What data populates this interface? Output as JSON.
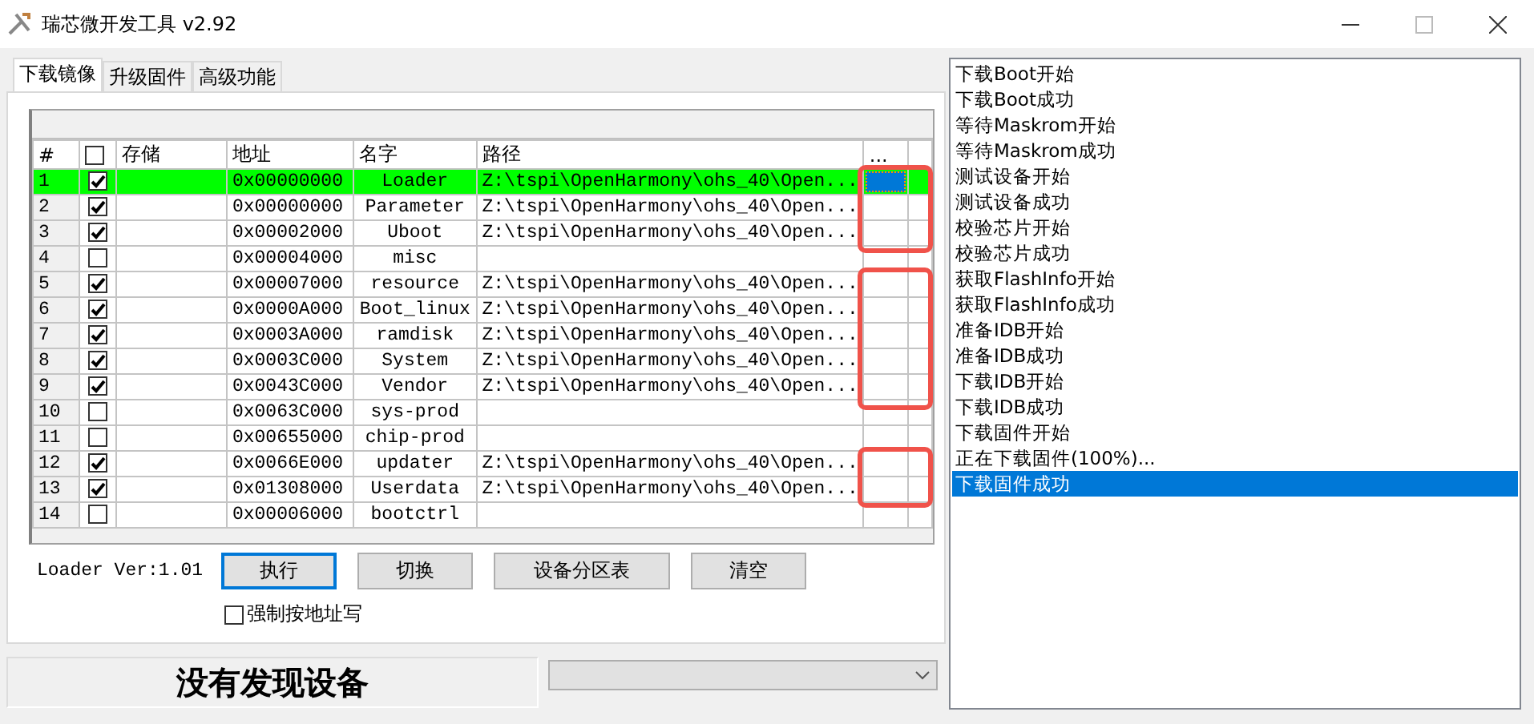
{
  "window": {
    "title": "瑞芯微开发工具 v2.92"
  },
  "tabs": [
    {
      "label": "下载镜像",
      "selected": true
    },
    {
      "label": "升级固件",
      "selected": false
    },
    {
      "label": "高级功能",
      "selected": false
    }
  ],
  "table": {
    "columns": [
      {
        "kind": "text",
        "label": "#"
      },
      {
        "kind": "checkbox",
        "checked": false
      },
      {
        "kind": "text",
        "label": "存储"
      },
      {
        "kind": "text",
        "label": "地址"
      },
      {
        "kind": "text",
        "label": "名字"
      },
      {
        "kind": "text",
        "label": "路径"
      },
      {
        "kind": "text",
        "label": "..."
      }
    ],
    "rows": [
      {
        "index": "1",
        "checked": true,
        "address": "0x00000000",
        "name": "Loader",
        "path": "Z:\\tspi\\OpenHarmony\\ohs_40\\Open...",
        "selected": true,
        "highlighted": true
      },
      {
        "index": "2",
        "checked": true,
        "address": "0x00000000",
        "name": "Parameter",
        "path": "Z:\\tspi\\OpenHarmony\\ohs_40\\Open...",
        "selected": false,
        "highlighted": true
      },
      {
        "index": "3",
        "checked": true,
        "address": "0x00002000",
        "name": "Uboot",
        "path": "Z:\\tspi\\OpenHarmony\\ohs_40\\Open...",
        "selected": false,
        "highlighted": true
      },
      {
        "index": "4",
        "checked": false,
        "address": "0x00004000",
        "name": "misc",
        "selected": false,
        "highlighted": false
      },
      {
        "index": "5",
        "checked": true,
        "address": "0x00007000",
        "name": "resource",
        "path": "Z:\\tspi\\OpenHarmony\\ohs_40\\Open...",
        "selected": false,
        "highlighted": true
      },
      {
        "index": "6",
        "checked": true,
        "address": "0x0000A000",
        "name": "Boot_linux",
        "path": "Z:\\tspi\\OpenHarmony\\ohs_40\\Open...",
        "selected": false,
        "highlighted": true
      },
      {
        "index": "7",
        "checked": true,
        "address": "0x0003A000",
        "name": "ramdisk",
        "path": "Z:\\tspi\\OpenHarmony\\ohs_40\\Open...",
        "selected": false,
        "highlighted": true
      },
      {
        "index": "8",
        "checked": true,
        "address": "0x0003C000",
        "name": "System",
        "path": "Z:\\tspi\\OpenHarmony\\ohs_40\\Open...",
        "selected": false,
        "highlighted": true
      },
      {
        "index": "9",
        "checked": true,
        "address": "0x0043C000",
        "name": "Vendor",
        "path": "Z:\\tspi\\OpenHarmony\\ohs_40\\Open...",
        "selected": false,
        "highlighted": true
      },
      {
        "index": "10",
        "checked": false,
        "address": "0x0063C000",
        "name": "sys-prod",
        "selected": false,
        "highlighted": false
      },
      {
        "index": "11",
        "checked": false,
        "address": "0x00655000",
        "name": "chip-prod",
        "selected": false,
        "highlighted": false
      },
      {
        "index": "12",
        "checked": true,
        "address": "0x0066E000",
        "name": "updater",
        "path": "Z:\\tspi\\OpenHarmony\\ohs_40\\Open...",
        "selected": false,
        "highlighted": true
      },
      {
        "index": "13",
        "checked": true,
        "address": "0x01308000",
        "name": "Userdata",
        "path": "Z:\\tspi\\OpenHarmony\\ohs_40\\Open...",
        "selected": false,
        "highlighted": true
      },
      {
        "index": "14",
        "checked": false,
        "address": "0x00006000",
        "name": "bootctrl",
        "selected": false,
        "highlighted": false
      }
    ]
  },
  "loader_version": "Loader Ver:1.01",
  "buttons": [
    {
      "label": "执行",
      "focused": true
    },
    {
      "label": "切换",
      "focused": false
    },
    {
      "label": "设备分区表",
      "focused": false
    },
    {
      "label": "清空",
      "focused": false
    }
  ],
  "force_address_write": {
    "label": "强制按地址写",
    "checked": false
  },
  "status": "没有发现设备",
  "log": [
    {
      "text": "下载Boot开始",
      "selected": false
    },
    {
      "text": "下载Boot成功",
      "selected": false
    },
    {
      "text": "等待Maskrom开始",
      "selected": false
    },
    {
      "text": "等待Maskrom成功",
      "selected": false
    },
    {
      "text": "测试设备开始",
      "selected": false
    },
    {
      "text": "测试设备成功",
      "selected": false
    },
    {
      "text": "校验芯片开始",
      "selected": false
    },
    {
      "text": "校验芯片成功",
      "selected": false
    },
    {
      "text": "获取FlashInfo开始",
      "selected": false
    },
    {
      "text": "获取FlashInfo成功",
      "selected": false
    },
    {
      "text": "准备IDB开始",
      "selected": false
    },
    {
      "text": "准备IDB成功",
      "selected": false
    },
    {
      "text": "下载IDB开始",
      "selected": false
    },
    {
      "text": "下载IDB成功",
      "selected": false
    },
    {
      "text": "下载固件开始",
      "selected": false
    },
    {
      "text": "正在下载固件(100%)...",
      "selected": false
    },
    {
      "text": "下载固件成功",
      "selected": true
    }
  ]
}
